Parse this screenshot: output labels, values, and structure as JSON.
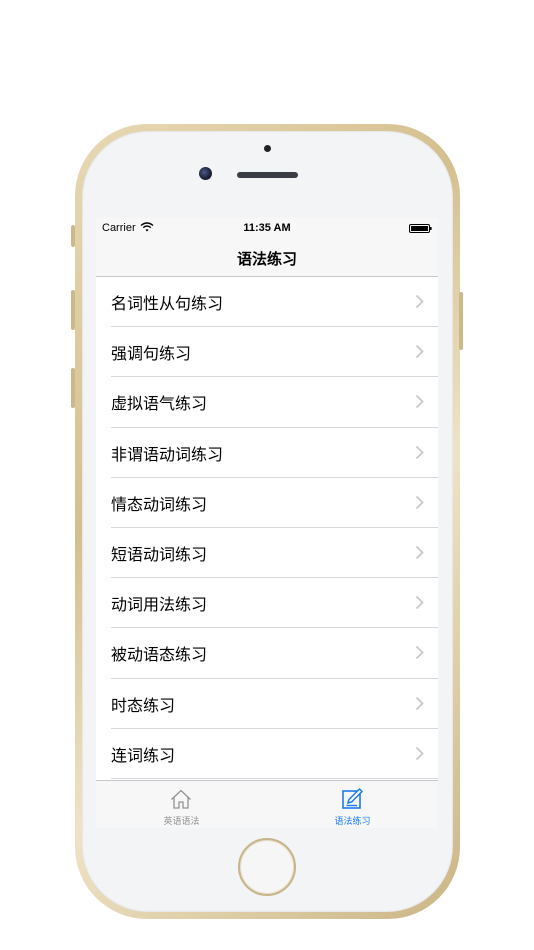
{
  "status_bar": {
    "carrier": "Carrier",
    "time": "11:35 AM"
  },
  "nav": {
    "title": "语法练习"
  },
  "list": {
    "items": [
      {
        "label": "名词性从句练习"
      },
      {
        "label": "强调句练习"
      },
      {
        "label": "虚拟语气练习"
      },
      {
        "label": "非谓语动词练习"
      },
      {
        "label": "情态动词练习"
      },
      {
        "label": "短语动词练习"
      },
      {
        "label": "动词用法练习"
      },
      {
        "label": "被动语态练习"
      },
      {
        "label": "时态练习"
      },
      {
        "label": "连词练习"
      }
    ]
  },
  "tab_bar": {
    "tabs": [
      {
        "label": "英语语法",
        "icon": "home-icon",
        "selected": false
      },
      {
        "label": "语法练习",
        "icon": "edit-icon",
        "selected": true
      }
    ]
  },
  "colors": {
    "accent": "#1a7cf0",
    "inactive": "#929292",
    "frame_gold": "#d4bf8e"
  }
}
